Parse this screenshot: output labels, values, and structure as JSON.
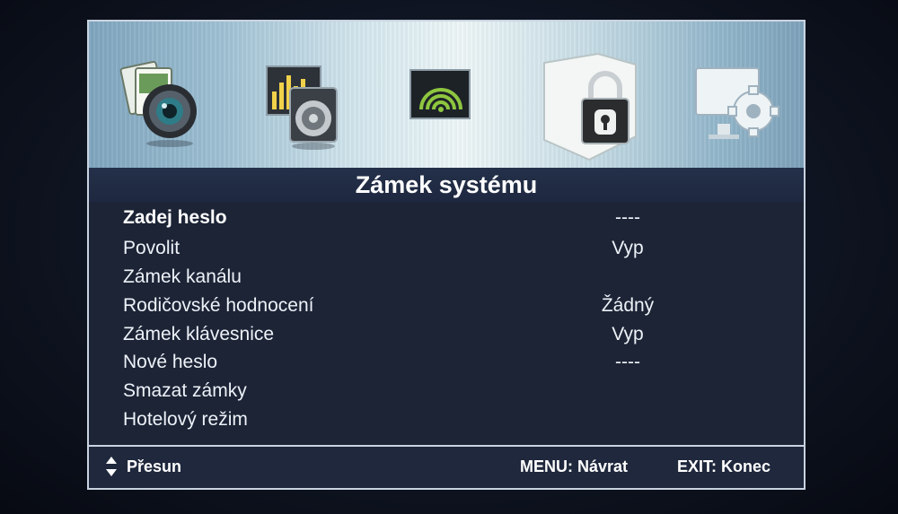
{
  "header": {
    "icons": [
      "media-camera-icon",
      "audio-speaker-icon",
      "channel-signal-icon",
      "system-lock-icon",
      "settings-display-icon"
    ],
    "active_index": 3
  },
  "title": "Zámek systému",
  "items": [
    {
      "label": "Zadej heslo",
      "value": "----"
    },
    {
      "label": "Povolit",
      "value": "Vyp"
    },
    {
      "label": "Zámek kanálu",
      "value": ""
    },
    {
      "label": "Rodičovské hodnocení",
      "value": "Žádný"
    },
    {
      "label": "Zámek klávesnice",
      "value": "Vyp"
    },
    {
      "label": "Nové heslo",
      "value": "----"
    },
    {
      "label": "Smazat zámky",
      "value": ""
    },
    {
      "label": "Hotelový režim",
      "value": ""
    }
  ],
  "selected_index": 0,
  "footer": {
    "move": "Přesun",
    "menu": "MENU: Návrat",
    "exit": "EXIT: Konec"
  },
  "colors": {
    "background": "#1c2436",
    "banner_accent": "#eef7f8",
    "text": "#eef2f8"
  }
}
